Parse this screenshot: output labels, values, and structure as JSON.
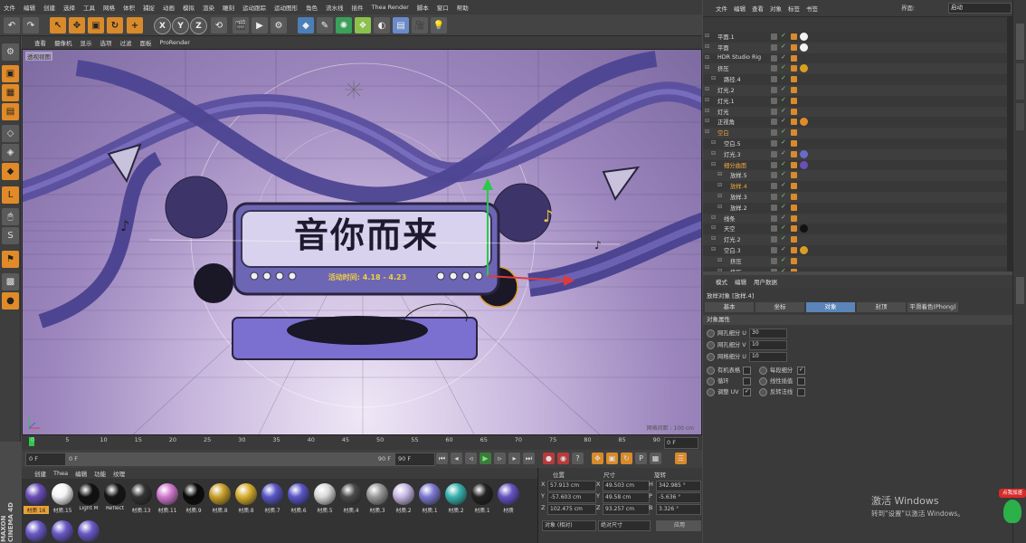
{
  "menubar": [
    "文件",
    "编辑",
    "创建",
    "选择",
    "工具",
    "网格",
    "体积",
    "捕捉",
    "动画",
    "模拟",
    "渲染",
    "雕刻",
    "运动跟踪",
    "运动图形",
    "角色",
    "流水线",
    "插件",
    "Thea Render",
    "脚本",
    "窗口",
    "帮助"
  ],
  "toolbar": {
    "axis_x": "X",
    "axis_y": "Y",
    "axis_z": "Z"
  },
  "viewport_menu": [
    "查看",
    "摄像机",
    "显示",
    "选项",
    "过滤",
    "面板",
    "ProRender"
  ],
  "viewport": {
    "label": "透视视图",
    "grid_spacing": "网格间距 : 100 cm",
    "title_text": "音你而来",
    "subtitle_text": "活动时间: 4.18 - 4.23"
  },
  "timeline": {
    "ticks": [
      "0",
      "5",
      "10",
      "15",
      "20",
      "25",
      "30",
      "35",
      "40",
      "45",
      "50",
      "55",
      "60",
      "65",
      "70",
      "75",
      "80",
      "85",
      "90"
    ],
    "current_frame": "0 F"
  },
  "playbar": {
    "start": "0 F",
    "min": "0 F",
    "max": "90 F",
    "end": "90 F"
  },
  "material_tabs": [
    "创建",
    "Thea",
    "编辑",
    "功能",
    "纹理"
  ],
  "materials": [
    {
      "name": "材质 16",
      "color": "#6a4fb8",
      "selected": true
    },
    {
      "name": "材质.15",
      "color": "#f4f4f4",
      "selected": false
    },
    {
      "name": "Light M",
      "color": "#111111",
      "selected": false
    },
    {
      "name": "Reflect",
      "color": "#151515",
      "selected": false
    },
    {
      "name": "材质.13",
      "color": "#333333",
      "selected": false
    },
    {
      "name": "材质.11",
      "color": "#d37ad1",
      "selected": false
    },
    {
      "name": "材质.9",
      "color": "#0a0a0a",
      "selected": false
    },
    {
      "name": "材质.8",
      "color": "#c9a02a",
      "selected": false
    },
    {
      "name": "材质.8",
      "color": "#d8b030",
      "selected": false
    },
    {
      "name": "材质.7",
      "color": "#5a56c8",
      "selected": false
    },
    {
      "name": "材质.6",
      "color": "#5a56c8",
      "selected": false
    },
    {
      "name": "材质.5",
      "color": "#d9d9d9",
      "selected": false
    },
    {
      "name": "材质.4",
      "color": "#4a4a4a",
      "selected": false
    },
    {
      "name": "材质.3",
      "color": "#9a9a9a",
      "selected": false
    },
    {
      "name": "材质.2",
      "color": "#c7b9e6",
      "selected": false
    },
    {
      "name": "材质.1",
      "color": "#7d7ad0",
      "selected": false
    },
    {
      "name": "材质.2",
      "color": "#39b3b0",
      "selected": false
    },
    {
      "name": "材质.1",
      "color": "#222222",
      "selected": false
    },
    {
      "name": "材质",
      "color": "#6654c4",
      "selected": false
    }
  ],
  "coords": {
    "headers": [
      "位置",
      "尺寸",
      "旋转"
    ],
    "rows": [
      {
        "axis": "X",
        "pos": "57.913 cm",
        "size_axis": "X",
        "size": "49.503 cm",
        "rot_axis": "H",
        "rot": "342.985 °"
      },
      {
        "axis": "Y",
        "pos": "-57.603 cm",
        "size_axis": "Y",
        "size": "49.58 cm",
        "rot_axis": "P",
        "rot": "-5.636 °"
      },
      {
        "axis": "Z",
        "pos": "102.475 cm",
        "size_axis": "Z",
        "size": "93.257 cm",
        "rot_axis": "B",
        "rot": "3.326 °"
      }
    ],
    "mode1": "对象 (相对)",
    "mode2": "绝对尺寸",
    "apply": "应用"
  },
  "right_menu": [
    "文件",
    "编辑",
    "查看",
    "对象",
    "标签",
    "书签"
  ],
  "layout_label": "界面:",
  "layout_value": "启动",
  "objects": [
    {
      "name": "平面.1",
      "indent": 0,
      "tag": "#f2f2f2",
      "hl": false
    },
    {
      "name": "平面",
      "indent": 0,
      "tag": "#f2f2f2",
      "hl": false
    },
    {
      "name": "HDR Studio Rig",
      "indent": 0,
      "tag": "",
      "hl": false
    },
    {
      "name": "挤压",
      "indent": 0,
      "tag": "#d8a020",
      "hl": false
    },
    {
      "name": "路径.4",
      "indent": 1,
      "tag": "",
      "hl": false
    },
    {
      "name": "灯光.2",
      "indent": 0,
      "tag": "",
      "hl": false
    },
    {
      "name": "灯光.1",
      "indent": 0,
      "tag": "",
      "hl": false
    },
    {
      "name": "灯光",
      "indent": 0,
      "tag": "",
      "hl": false
    },
    {
      "name": "正视角",
      "indent": 0,
      "tag": "#e08a28",
      "hl": false
    },
    {
      "name": "空白",
      "indent": 0,
      "tag": "",
      "hl": true
    },
    {
      "name": "空白.5",
      "indent": 1,
      "tag": "",
      "hl": false
    },
    {
      "name": "灯光.3",
      "indent": 1,
      "tag": "#6a6ac8",
      "hl": false
    },
    {
      "name": "细分曲面",
      "indent": 1,
      "tag": "#6a4fb8",
      "hl": true
    },
    {
      "name": "放样.5",
      "indent": 2,
      "tag": "",
      "hl": false
    },
    {
      "name": "放样.4",
      "indent": 2,
      "tag": "",
      "hl": true
    },
    {
      "name": "放样.3",
      "indent": 2,
      "tag": "",
      "hl": false
    },
    {
      "name": "放样.2",
      "indent": 2,
      "tag": "",
      "hl": false
    },
    {
      "name": "线条",
      "indent": 1,
      "tag": "",
      "hl": false
    },
    {
      "name": "天空",
      "indent": 1,
      "tag": "#111111",
      "hl": false
    },
    {
      "name": "灯光.2",
      "indent": 1,
      "tag": "",
      "hl": false
    },
    {
      "name": "空白.3",
      "indent": 1,
      "tag": "#d8a020",
      "hl": false
    },
    {
      "name": "挤压",
      "indent": 2,
      "tag": "",
      "hl": false
    },
    {
      "name": "挤压",
      "indent": 2,
      "tag": "",
      "hl": false
    }
  ],
  "attr_menu": [
    "模式",
    "编辑",
    "用户数据"
  ],
  "attr_title": "放样对象 [放样.4]",
  "attr_tabs": [
    "基本",
    "坐标",
    "对象",
    "封顶",
    "平滑着色(Phong)"
  ],
  "attr_section": "对象属性",
  "attr_fields": [
    {
      "label": "网孔细分 U",
      "value": "30"
    },
    {
      "label": "网孔细分 V",
      "value": "10"
    },
    {
      "label": "网格细分 U",
      "value": "10"
    }
  ],
  "attr_checks_left": [
    {
      "label": "有机表格",
      "checked": false
    },
    {
      "label": "循环",
      "checked": false
    },
    {
      "label": "调整 UV",
      "checked": true
    }
  ],
  "attr_checks_right": [
    {
      "label": "每段细分",
      "checked": true
    },
    {
      "label": "线性插值",
      "checked": false
    },
    {
      "label": "反转法线",
      "checked": false
    }
  ],
  "watermark": {
    "title": "激活 Windows",
    "subtitle": "转到\"设置\"以激活 Windows。"
  },
  "logo": "MAXON CINEMA 4D",
  "corner_badge": "点我加速"
}
